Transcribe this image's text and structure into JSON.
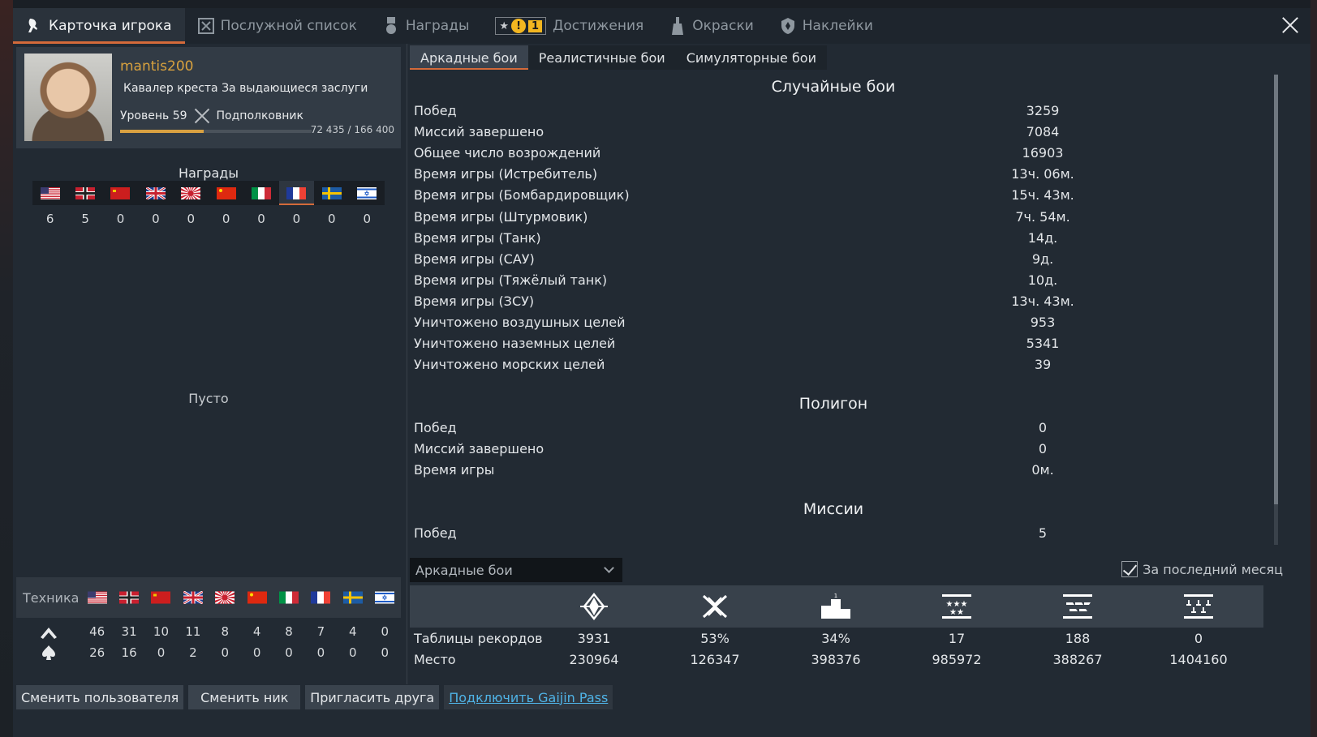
{
  "tabs": [
    {
      "label": "Карточка игрока",
      "icon": "player-card-icon",
      "active": true
    },
    {
      "label": "Послужной список",
      "icon": "service-record-icon",
      "active": false
    },
    {
      "label": "Награды",
      "icon": "medal-icon",
      "active": false
    },
    {
      "label": "Достижения",
      "icon": "achievements-icon",
      "active": false,
      "badge_count": "1"
    },
    {
      "label": "Окраски",
      "icon": "camouflage-icon",
      "active": false
    },
    {
      "label": "Наклейки",
      "icon": "decals-icon",
      "active": false
    }
  ],
  "profile": {
    "username": "mantis200",
    "title": "Кавалер креста За выдающиеся заслуги",
    "level": "Уровень 59",
    "rank": "Подполковник",
    "xp_text": "72 435 / 166 400",
    "xp_fraction": 0.435
  },
  "awards": {
    "title": "Награды",
    "nations": [
      "usa",
      "germany",
      "ussr",
      "britain",
      "japan",
      "china",
      "italy",
      "france",
      "sweden",
      "israel"
    ],
    "selected_index": 7,
    "counts": [
      "6",
      "5",
      "0",
      "0",
      "0",
      "0",
      "0",
      "0",
      "0",
      "0"
    ],
    "empty_text": "Пусто"
  },
  "vehicles": {
    "label": "Техника",
    "researched": [
      "46",
      "31",
      "10",
      "11",
      "8",
      "4",
      "8",
      "7",
      "4",
      "0"
    ],
    "elite": [
      "26",
      "16",
      "0",
      "2",
      "0",
      "0",
      "0",
      "0",
      "0",
      "0"
    ]
  },
  "mode_tabs": [
    "Аркадные бои",
    "Реалистичные бои",
    "Симуляторные бои"
  ],
  "sections": {
    "random": {
      "title": "Случайные бои",
      "rows": [
        {
          "name": "Побед",
          "value": "3259"
        },
        {
          "name": "Миссий завершено",
          "value": "7084"
        },
        {
          "name": "Общее число возрождений",
          "value": "16903"
        },
        {
          "name": "Время игры (Истребитель)",
          "value": "13ч. 06м."
        },
        {
          "name": "Время игры (Бомбардировщик)",
          "value": "15ч. 43м."
        },
        {
          "name": "Время игры (Штурмовик)",
          "value": "7ч. 54м."
        },
        {
          "name": "Время игры (Танк)",
          "value": "14д."
        },
        {
          "name": "Время игры (САУ)",
          "value": "9д."
        },
        {
          "name": "Время игры (Тяжёлый танк)",
          "value": "10д."
        },
        {
          "name": "Время игры (ЗСУ)",
          "value": "13ч. 43м."
        },
        {
          "name": "Уничтожено воздушных целей",
          "value": "953"
        },
        {
          "name": "Уничтожено наземных целей",
          "value": "5341"
        },
        {
          "name": "Уничтожено морских целей",
          "value": "39"
        }
      ]
    },
    "polygon": {
      "title": "Полигон",
      "rows": [
        {
          "name": "Побед",
          "value": "0"
        },
        {
          "name": "Миссий завершено",
          "value": "0"
        },
        {
          "name": "Время игры",
          "value": "0м."
        }
      ]
    },
    "missions": {
      "title": "Миссии",
      "rows": [
        {
          "name": "Побед",
          "value": "5"
        }
      ]
    }
  },
  "leaderboard": {
    "dropdown_value": "Аркадные бои",
    "last_month_label": "За последний месяц",
    "last_month_checked": true,
    "icons": [
      "victories-icon",
      "win-rate-icon",
      "podium-icon",
      "air-kills-icon",
      "ground-kills-icon",
      "naval-kills-icon"
    ],
    "records_label": "Таблицы рекордов",
    "records": [
      "3931",
      "53%",
      "34%",
      "17",
      "188",
      "0"
    ],
    "place_label": "Место",
    "places": [
      "230964",
      "126347",
      "398376",
      "985972",
      "388267",
      "1404160"
    ]
  },
  "buttons": {
    "switch_user": "Сменить пользователя",
    "change_nick": "Сменить ник",
    "invite_friend": "Пригласить друга",
    "gaijin_pass": "Подключить Gaijin Pass"
  }
}
